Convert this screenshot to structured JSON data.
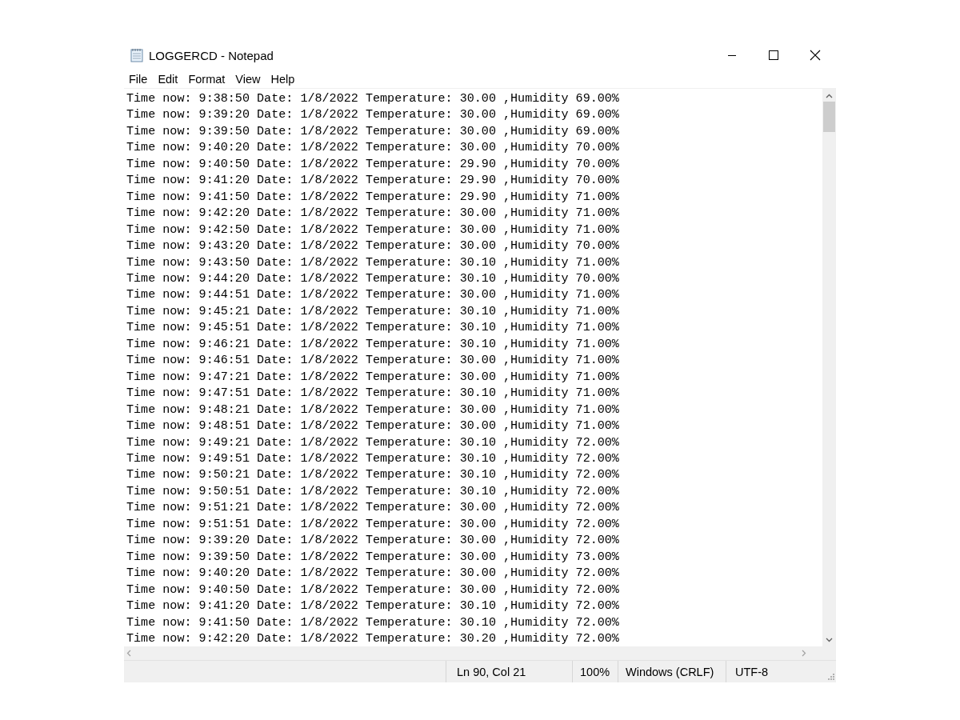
{
  "window": {
    "title": "LOGGERCD - Notepad"
  },
  "menu": [
    "File",
    "Edit",
    "Format",
    "View",
    "Help"
  ],
  "lines": [
    "Time now: 9:38:50 Date: 1/8/2022 Temperature: 30.00 ,Humidity 69.00%",
    "Time now: 9:39:20 Date: 1/8/2022 Temperature: 30.00 ,Humidity 69.00%",
    "Time now: 9:39:50 Date: 1/8/2022 Temperature: 30.00 ,Humidity 69.00%",
    "Time now: 9:40:20 Date: 1/8/2022 Temperature: 30.00 ,Humidity 70.00%",
    "Time now: 9:40:50 Date: 1/8/2022 Temperature: 29.90 ,Humidity 70.00%",
    "Time now: 9:41:20 Date: 1/8/2022 Temperature: 29.90 ,Humidity 70.00%",
    "Time now: 9:41:50 Date: 1/8/2022 Temperature: 29.90 ,Humidity 71.00%",
    "Time now: 9:42:20 Date: 1/8/2022 Temperature: 30.00 ,Humidity 71.00%",
    "Time now: 9:42:50 Date: 1/8/2022 Temperature: 30.00 ,Humidity 71.00%",
    "Time now: 9:43:20 Date: 1/8/2022 Temperature: 30.00 ,Humidity 70.00%",
    "Time now: 9:43:50 Date: 1/8/2022 Temperature: 30.10 ,Humidity 71.00%",
    "Time now: 9:44:20 Date: 1/8/2022 Temperature: 30.10 ,Humidity 70.00%",
    "Time now: 9:44:51 Date: 1/8/2022 Temperature: 30.00 ,Humidity 71.00%",
    "Time now: 9:45:21 Date: 1/8/2022 Temperature: 30.10 ,Humidity 71.00%",
    "Time now: 9:45:51 Date: 1/8/2022 Temperature: 30.10 ,Humidity 71.00%",
    "Time now: 9:46:21 Date: 1/8/2022 Temperature: 30.10 ,Humidity 71.00%",
    "Time now: 9:46:51 Date: 1/8/2022 Temperature: 30.00 ,Humidity 71.00%",
    "Time now: 9:47:21 Date: 1/8/2022 Temperature: 30.00 ,Humidity 71.00%",
    "Time now: 9:47:51 Date: 1/8/2022 Temperature: 30.10 ,Humidity 71.00%",
    "Time now: 9:48:21 Date: 1/8/2022 Temperature: 30.00 ,Humidity 71.00%",
    "Time now: 9:48:51 Date: 1/8/2022 Temperature: 30.00 ,Humidity 71.00%",
    "Time now: 9:49:21 Date: 1/8/2022 Temperature: 30.10 ,Humidity 72.00%",
    "Time now: 9:49:51 Date: 1/8/2022 Temperature: 30.10 ,Humidity 72.00%",
    "Time now: 9:50:21 Date: 1/8/2022 Temperature: 30.10 ,Humidity 72.00%",
    "Time now: 9:50:51 Date: 1/8/2022 Temperature: 30.10 ,Humidity 72.00%",
    "Time now: 9:51:21 Date: 1/8/2022 Temperature: 30.00 ,Humidity 72.00%",
    "Time now: 9:51:51 Date: 1/8/2022 Temperature: 30.00 ,Humidity 72.00%",
    "Time now: 9:39:20 Date: 1/8/2022 Temperature: 30.00 ,Humidity 72.00%",
    "Time now: 9:39:50 Date: 1/8/2022 Temperature: 30.00 ,Humidity 73.00%",
    "Time now: 9:40:20 Date: 1/8/2022 Temperature: 30.00 ,Humidity 72.00%",
    "Time now: 9:40:50 Date: 1/8/2022 Temperature: 30.00 ,Humidity 72.00%",
    "Time now: 9:41:20 Date: 1/8/2022 Temperature: 30.10 ,Humidity 72.00%",
    "Time now: 9:41:50 Date: 1/8/2022 Temperature: 30.10 ,Humidity 72.00%",
    "Time now: 9:42:20 Date: 1/8/2022 Temperature: 30.20 ,Humidity 72.00%"
  ],
  "status_bar": {
    "position": "Ln 90, Col 21",
    "zoom": "100%",
    "line_endings": "Windows (CRLF)",
    "encoding": "UTF-8"
  }
}
